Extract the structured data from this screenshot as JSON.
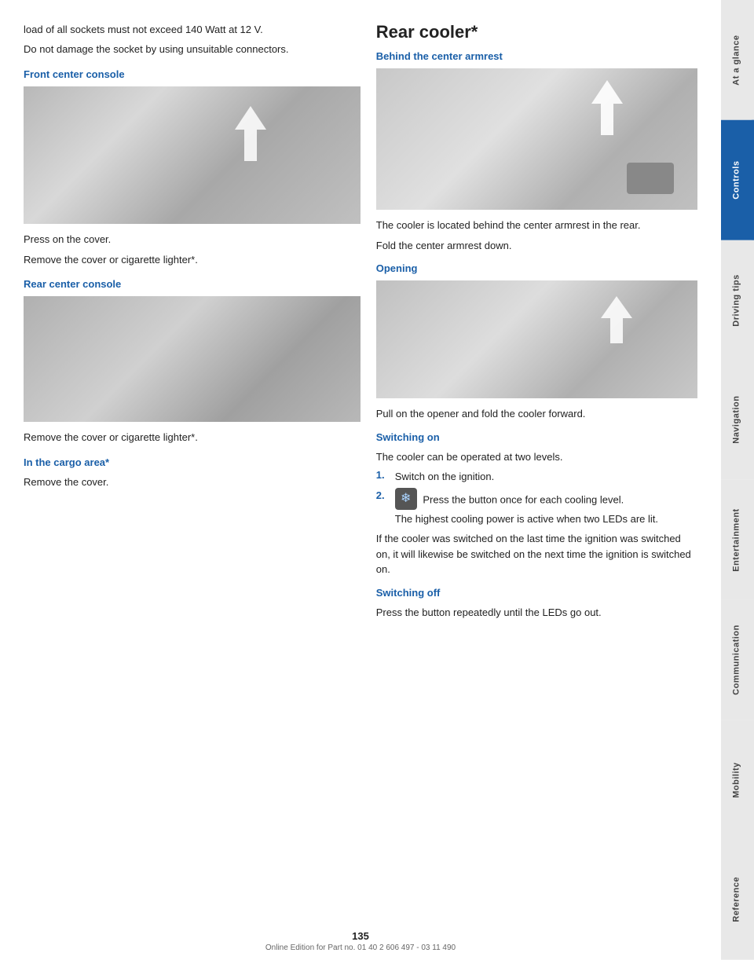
{
  "page": {
    "number": "135",
    "footer_text": "Online Edition for Part no. 01 40 2 606 497 - 03 11 490"
  },
  "left_col": {
    "intro": [
      "load of all sockets must not exceed 140 Watt at 12 V.",
      "Do not damage the socket by using unsuitable connectors."
    ],
    "front_center_console": {
      "heading": "Front center console",
      "instructions": [
        "Press on the cover.",
        "Remove the cover or cigarette lighter*."
      ]
    },
    "rear_center_console": {
      "heading": "Rear center console",
      "instructions": [
        "Remove the cover or cigarette lighter*."
      ]
    },
    "cargo_area": {
      "heading": "In the cargo area*",
      "instructions": [
        "Remove the cover."
      ]
    }
  },
  "right_col": {
    "title": "Rear cooler*",
    "behind_armrest": {
      "heading": "Behind the center armrest",
      "body": [
        "The cooler is located behind the center armrest in the rear.",
        "Fold the center armrest down."
      ]
    },
    "opening": {
      "heading": "Opening",
      "body": "Pull on the opener and fold the cooler forward."
    },
    "switching_on": {
      "heading": "Switching on",
      "body": "The cooler can be operated at two levels.",
      "steps": [
        {
          "num": "1.",
          "text": "Switch on the ignition."
        },
        {
          "num": "2.",
          "text": "Press the button once for each cooling level.\nThe highest cooling power is active when two LEDs are lit."
        }
      ],
      "note": "If the cooler was switched on the last time the ignition was switched on, it will likewise be switched on the next time the ignition is switched on."
    },
    "switching_off": {
      "heading": "Switching off",
      "body": "Press the button repeatedly until the LEDs go out."
    }
  },
  "sidebar": {
    "tabs": [
      {
        "label": "At a glance",
        "active": false
      },
      {
        "label": "Controls",
        "active": true
      },
      {
        "label": "Driving tips",
        "active": false
      },
      {
        "label": "Navigation",
        "active": false
      },
      {
        "label": "Entertainment",
        "active": false
      },
      {
        "label": "Communication",
        "active": false
      },
      {
        "label": "Mobility",
        "active": false
      },
      {
        "label": "Reference",
        "active": false
      }
    ]
  }
}
